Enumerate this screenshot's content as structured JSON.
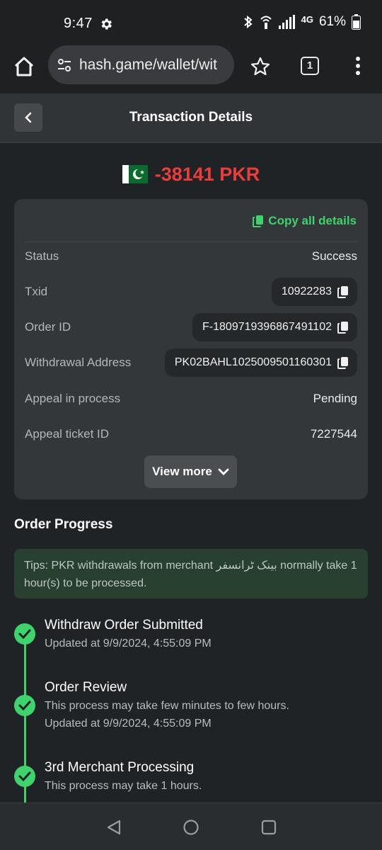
{
  "status_bar": {
    "time": "9:47",
    "network": "4G",
    "battery": "61%",
    "icons": [
      "gear-icon",
      "bluetooth-icon",
      "hotspot-icon",
      "signal-icon",
      "battery-icon"
    ]
  },
  "browser": {
    "url": "hash.game/wallet/wit",
    "tab_count": "1",
    "icons": [
      "home-icon",
      "site-settings-icon",
      "star-icon",
      "tabs-icon",
      "more-vert-icon"
    ]
  },
  "header": {
    "title": "Transaction Details",
    "back_icon": "chevron-left-icon"
  },
  "amount": {
    "value": "-38141 PKR",
    "flag": "pakistan-flag",
    "color": "#ee3b3b"
  },
  "details": {
    "copy_all_label": "Copy all details",
    "rows": [
      {
        "label": "Status",
        "value": "Success"
      },
      {
        "label": "Txid",
        "value": "10922283"
      },
      {
        "label": "Order ID",
        "value": "F-1809719396867491102"
      },
      {
        "label": "Withdrawal Address",
        "value": "PK02BAHL1025009501160301"
      },
      {
        "label": "Appeal in process",
        "value": "Pending"
      },
      {
        "label": "Appeal ticket ID",
        "value": "7227544"
      }
    ],
    "view_more_label": "View more"
  },
  "progress": {
    "title": "Order Progress",
    "tips": "Tips: PKR withdrawals from merchant بینک ٹرانسفر normally take 1 hour(s) to be processed.",
    "steps": [
      {
        "title": "Withdraw Order Submitted",
        "line1": "Updated at 9/9/2024, 4:55:09 PM",
        "line2": ""
      },
      {
        "title": "Order Review",
        "line1": "This process may take few minutes to few hours.",
        "line2": "Updated at 9/9/2024, 4:55:09 PM"
      },
      {
        "title": "3rd Merchant Processing",
        "line1": "This process may take 1 hours.",
        "line2": ""
      }
    ]
  },
  "colors": {
    "accent_green": "#3ed36c",
    "negative_red": "#ee3b3b",
    "background": "#202325",
    "card": "#33373a"
  },
  "nav_bar": {
    "icons": [
      "back-triangle-icon",
      "home-circle-icon",
      "recents-square-icon"
    ]
  }
}
